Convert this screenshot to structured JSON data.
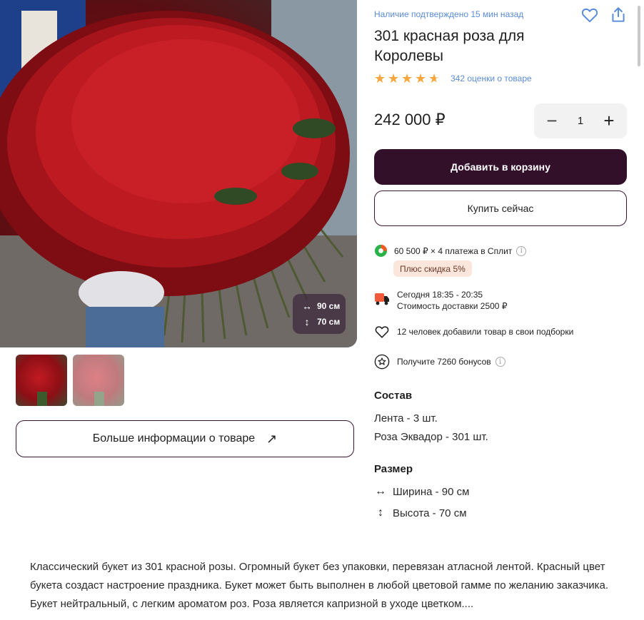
{
  "gallery": {
    "width_badge": "90 см",
    "height_badge": "70 см",
    "more_info_button": "Больше информации о товаре"
  },
  "product": {
    "availability": "Наличие подтверждено 15 мин назад",
    "title": "301 красная роза для Королевы",
    "rating_stars": 4.5,
    "rating_count": "342 оценки о товаре",
    "price": "242 000 ₽",
    "quantity": "1"
  },
  "actions": {
    "add_to_cart": "Добавить в корзину",
    "buy_now": "Купить сейчас"
  },
  "split": {
    "text": "60 500 ₽ × 4 платежа в Сплит",
    "discount": "Плюс скидка 5%"
  },
  "delivery": {
    "time": "Сегодня 18:35 - 20:35",
    "cost": "Стоимость доставки 2500 ₽"
  },
  "favorites_text": "12 человек добавили товар в свои подборки",
  "bonus_text": "Получите 7260 бонусов",
  "composition": {
    "heading": "Состав",
    "items": [
      "Лента - 3 шт.",
      "Роза Эквадор - 301 шт."
    ]
  },
  "size": {
    "heading": "Размер",
    "width": "Ширина - 90 см",
    "height": "Высота - 70 см"
  },
  "description": "Классический букет из 301 красной розы. Огромный букет без упаковки, перевязан атласной лентой. Красный цвет букета создаст настроение праздника. Букет может быть выполнен в любой цветовой гамме по желанию заказчика. Букет нейтральный, с легким ароматом роз. Роза является капризной в уходе цветком....",
  "colors": {
    "accent_dark": "#33102a",
    "link_blue": "#5a8bd8",
    "star_orange": "#f6a63c"
  }
}
